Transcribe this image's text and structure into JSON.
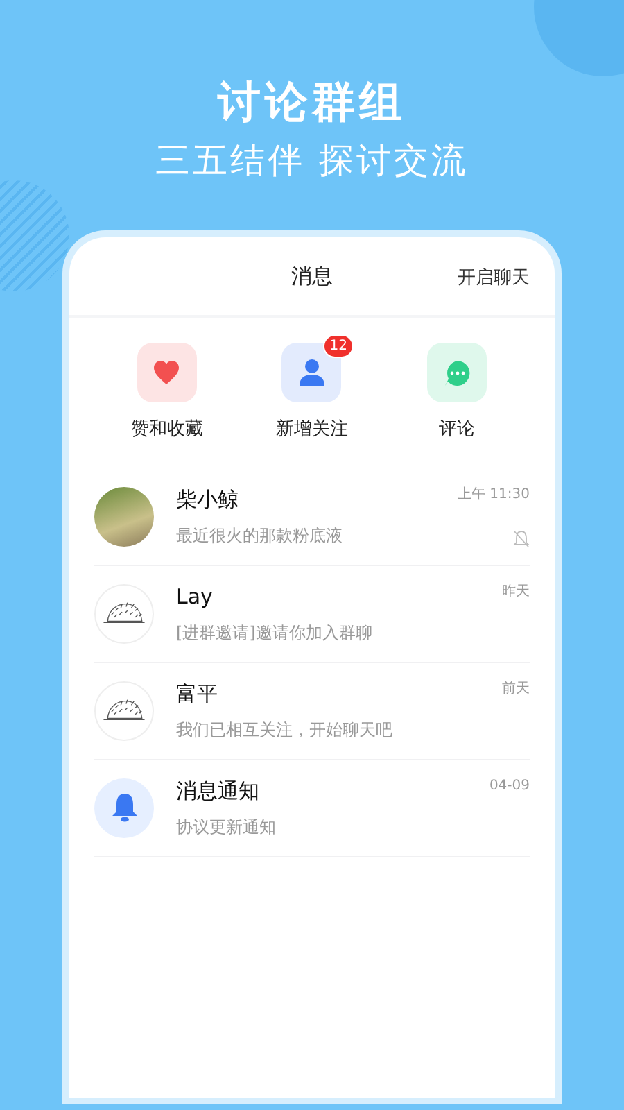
{
  "promo": {
    "title": "讨论群组",
    "subtitle": "三五结伴 探讨交流"
  },
  "header": {
    "title": "消息",
    "action": "开启聊天"
  },
  "shortcuts": [
    {
      "kind": "heart",
      "label": "赞和收藏"
    },
    {
      "kind": "person",
      "label": "新增关注",
      "badge": "12"
    },
    {
      "kind": "chat",
      "label": "评论"
    }
  ],
  "conversations": [
    {
      "kind": "photo",
      "name": "柴小鲸",
      "preview": "最近很火的那款粉底液",
      "time": "上午 11:30",
      "muted": true
    },
    {
      "kind": "hedgehog",
      "name": "Lay",
      "preview": "[进群邀请]邀请你加入群聊",
      "time": "昨天",
      "muted": false
    },
    {
      "kind": "hedgehog",
      "name": "富平",
      "preview": "我们已相互关注，开始聊天吧",
      "time": "前天",
      "muted": false
    },
    {
      "kind": "bell",
      "name": "消息通知",
      "preview": "协议更新通知",
      "time": "04-09",
      "muted": false
    }
  ]
}
